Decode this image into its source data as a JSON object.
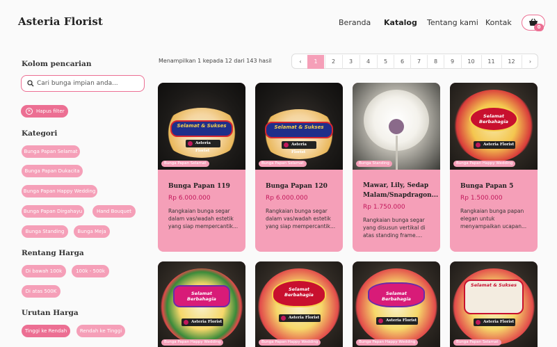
{
  "brand": "Asteria Florist",
  "nav": {
    "home": "Beranda",
    "catalog": "Katalog",
    "about": "Tentang kami",
    "contact": "Kontak",
    "cart_count": "0"
  },
  "sidebar": {
    "search_title": "Kolom pencarian",
    "search_placeholder": "Cari bunga impian anda...",
    "clear_filter": "Hapus filter",
    "category_title": "Kategori",
    "categories": [
      "Bunga Papan Selamat",
      "Bunga Papan Dukacita",
      "Bunga Papan Happy Wedding",
      "Bunga Papan Dirgahayu",
      "Hand Bouquet",
      "Bunga Standing",
      "Bunga Meja"
    ],
    "price_title": "Rentang Harga",
    "prices": [
      "Di bawah 100k",
      "100k - 500k",
      "Di atas 500K"
    ],
    "sort_title": "Urutan Harga",
    "sorts": [
      "Tinggi ke Rendah",
      "Rendah ke Tinggi"
    ]
  },
  "results": {
    "summary": "Menampilkan 1 kepada 12 dari 143 hasil",
    "prev": "‹",
    "next": "›",
    "pages": [
      "1",
      "2",
      "3",
      "4",
      "5",
      "6",
      "7",
      "8",
      "9",
      "10",
      "11",
      "12"
    ],
    "active_page": "1"
  },
  "products": [
    {
      "tag": "Bunga Papan Selamat",
      "title": "Bunga Papan 119",
      "price": "Rp 6.000.000",
      "desc": "Rangkaian bunga segar dalam vas/wadah estetik yang siap mempercantik...",
      "banner_text": "Selamat & Sukses",
      "logo": "Asteria Florist"
    },
    {
      "tag": "Bunga Papan Selamat",
      "title": "Bunga Papan 120",
      "price": "Rp 6.000.000",
      "desc": "Rangkaian bunga segar dalam vas/wadah estetik yang siap mempercantik...",
      "banner_text": "Selamat & Sukses",
      "logo": "Asteria Florist"
    },
    {
      "tag": "Bunga Standing",
      "title": "Mawar, Lily, Sedap Malam/Snapdragon...",
      "price": "Rp 1.750.000",
      "desc": "Rangkaian bunga segar yang disusun vertikal di atas standing frame....",
      "banner_text": "",
      "logo": ""
    },
    {
      "tag": "Bunga Papan Happy Wedding",
      "title": "Bunga Papan 5",
      "price": "Rp 1.500.000",
      "desc": "Rangkaian bunga papan elegan untuk menyampaikan ucapan...",
      "banner_text": "Selamat Berbahagia",
      "logo": "Asteria Florist"
    },
    {
      "tag": "Bunga Papan Happy Wedding",
      "banner_text": "Selamat Berbahagia",
      "logo": "Asteria Florist"
    },
    {
      "tag": "Bunga Papan Happy Wedding",
      "banner_text": "Selamat Berbahagia",
      "logo": "Asteria Florist"
    },
    {
      "tag": "Bunga Papan Happy Wedding",
      "banner_text": "Selamat Berbahagia",
      "logo": "Asteria Florist"
    },
    {
      "tag": "Bunga Papan Selamat",
      "banner_text": "Selamat & Sukses",
      "logo": "Asteria Florist"
    }
  ],
  "colors": {
    "accent": "#ec6f93",
    "accent_light": "#f59fb8",
    "price": "#c2185b"
  }
}
